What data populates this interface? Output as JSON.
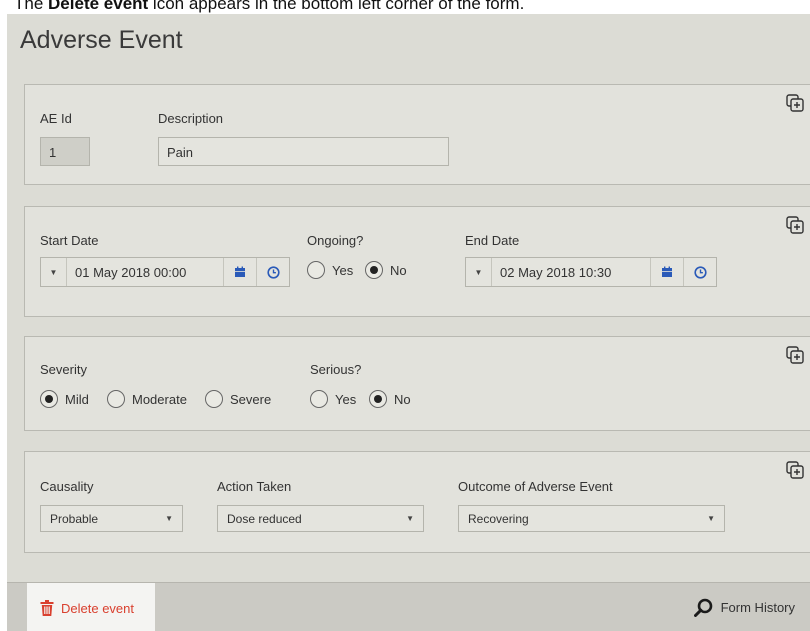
{
  "caption": {
    "pre": "The ",
    "bold": "Delete event",
    "post": " icon appears in the bottom left corner of the form."
  },
  "form": {
    "title": "Adverse Event",
    "panel1": {
      "ae_id_label": "AE Id",
      "ae_id_value": "1",
      "description_label": "Description",
      "description_value": "Pain"
    },
    "panel2": {
      "start_date_label": "Start Date",
      "start_date_value": "01 May 2018 00:00",
      "ongoing_label": "Ongoing?",
      "ongoing_options": [
        "Yes",
        "No"
      ],
      "ongoing_selected": "No",
      "end_date_label": "End Date",
      "end_date_value": "02 May 2018 10:30"
    },
    "panel3": {
      "severity_label": "Severity",
      "severity_options": [
        "Mild",
        "Moderate",
        "Severe"
      ],
      "severity_selected": "Mild",
      "serious_label": "Serious?",
      "serious_options": [
        "Yes",
        "No"
      ],
      "serious_selected": "No"
    },
    "panel4": {
      "causality_label": "Causality",
      "causality_value": "Probable",
      "action_label": "Action Taken",
      "action_value": "Dose reduced",
      "outcome_label": "Outcome of Adverse Event",
      "outcome_value": "Recovering"
    },
    "footer": {
      "delete_label": "Delete event",
      "history_label": "Form History"
    }
  },
  "colors": {
    "delete": "#d9402f",
    "accent_blue": "#2a5ab8"
  },
  "icons": [
    "duplicate-icon",
    "calendar-icon",
    "clock-icon",
    "trash-icon",
    "search-icon"
  ]
}
